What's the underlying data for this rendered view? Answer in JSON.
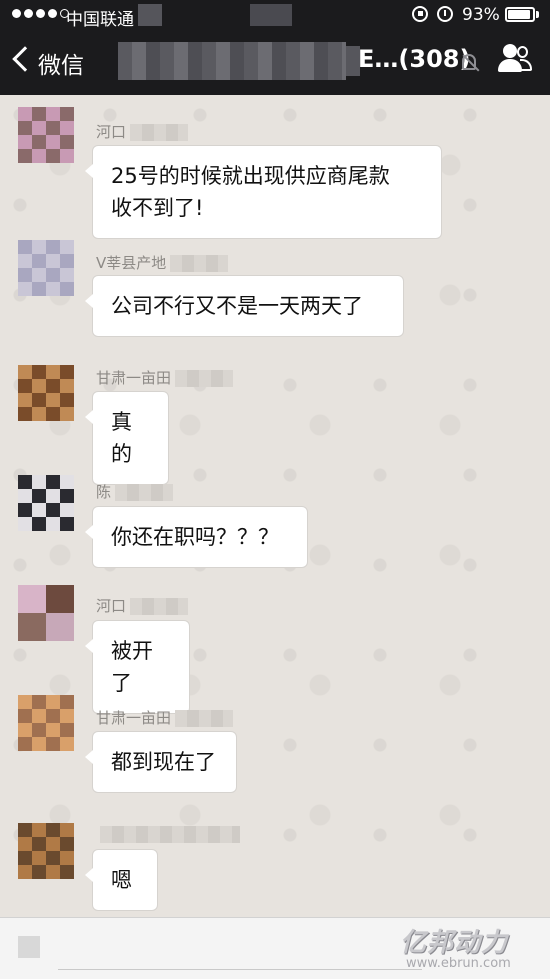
{
  "status_bar": {
    "carrier": "中国联通",
    "battery": "93%",
    "battery_level": 0.93
  },
  "nav": {
    "back_label": "微信",
    "title": "E…(308)"
  },
  "messages": [
    {
      "sender": "河口",
      "text_lines": [
        "25号的时候就出现供应商尾款",
        "收不到了!"
      ]
    },
    {
      "sender": "V莘县产地",
      "text_lines": [
        "公司不行又不是一天两天了"
      ]
    },
    {
      "sender": "甘肃一亩田",
      "text_lines": [
        "真的"
      ]
    },
    {
      "sender": "陈",
      "text_lines": [
        "你还在职吗？？？"
      ]
    },
    {
      "sender": "河口",
      "text_lines": [
        "被开了"
      ]
    },
    {
      "sender": "甘肃一亩田",
      "text_lines": [
        "都到现在了"
      ]
    },
    {
      "sender": "",
      "text_lines": [
        "嗯"
      ]
    }
  ],
  "watermark": {
    "logo": "亿邦动力",
    "url": "www.ebrun.com"
  }
}
